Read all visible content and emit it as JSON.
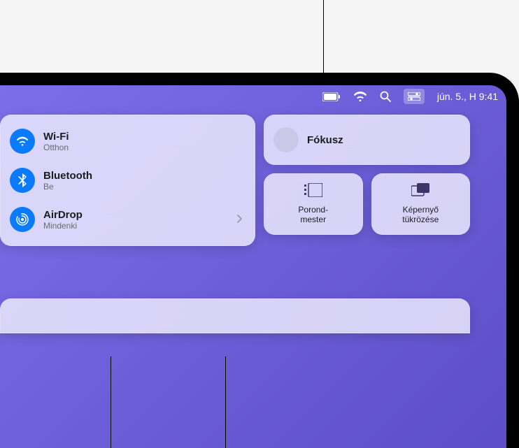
{
  "menubar": {
    "date_time": "jún. 5., H  9:41"
  },
  "connectivity": {
    "wifi": {
      "title": "Wi-Fi",
      "status": "Otthon"
    },
    "bluetooth": {
      "title": "Bluetooth",
      "status": "Be"
    },
    "airdrop": {
      "title": "AirDrop",
      "status": "Mindenki"
    }
  },
  "focus": {
    "label": "Fókusz"
  },
  "stage_manager": {
    "label": "Porond-\nmester"
  },
  "screen_mirroring": {
    "label": "Képernyő\ntükrözése"
  }
}
